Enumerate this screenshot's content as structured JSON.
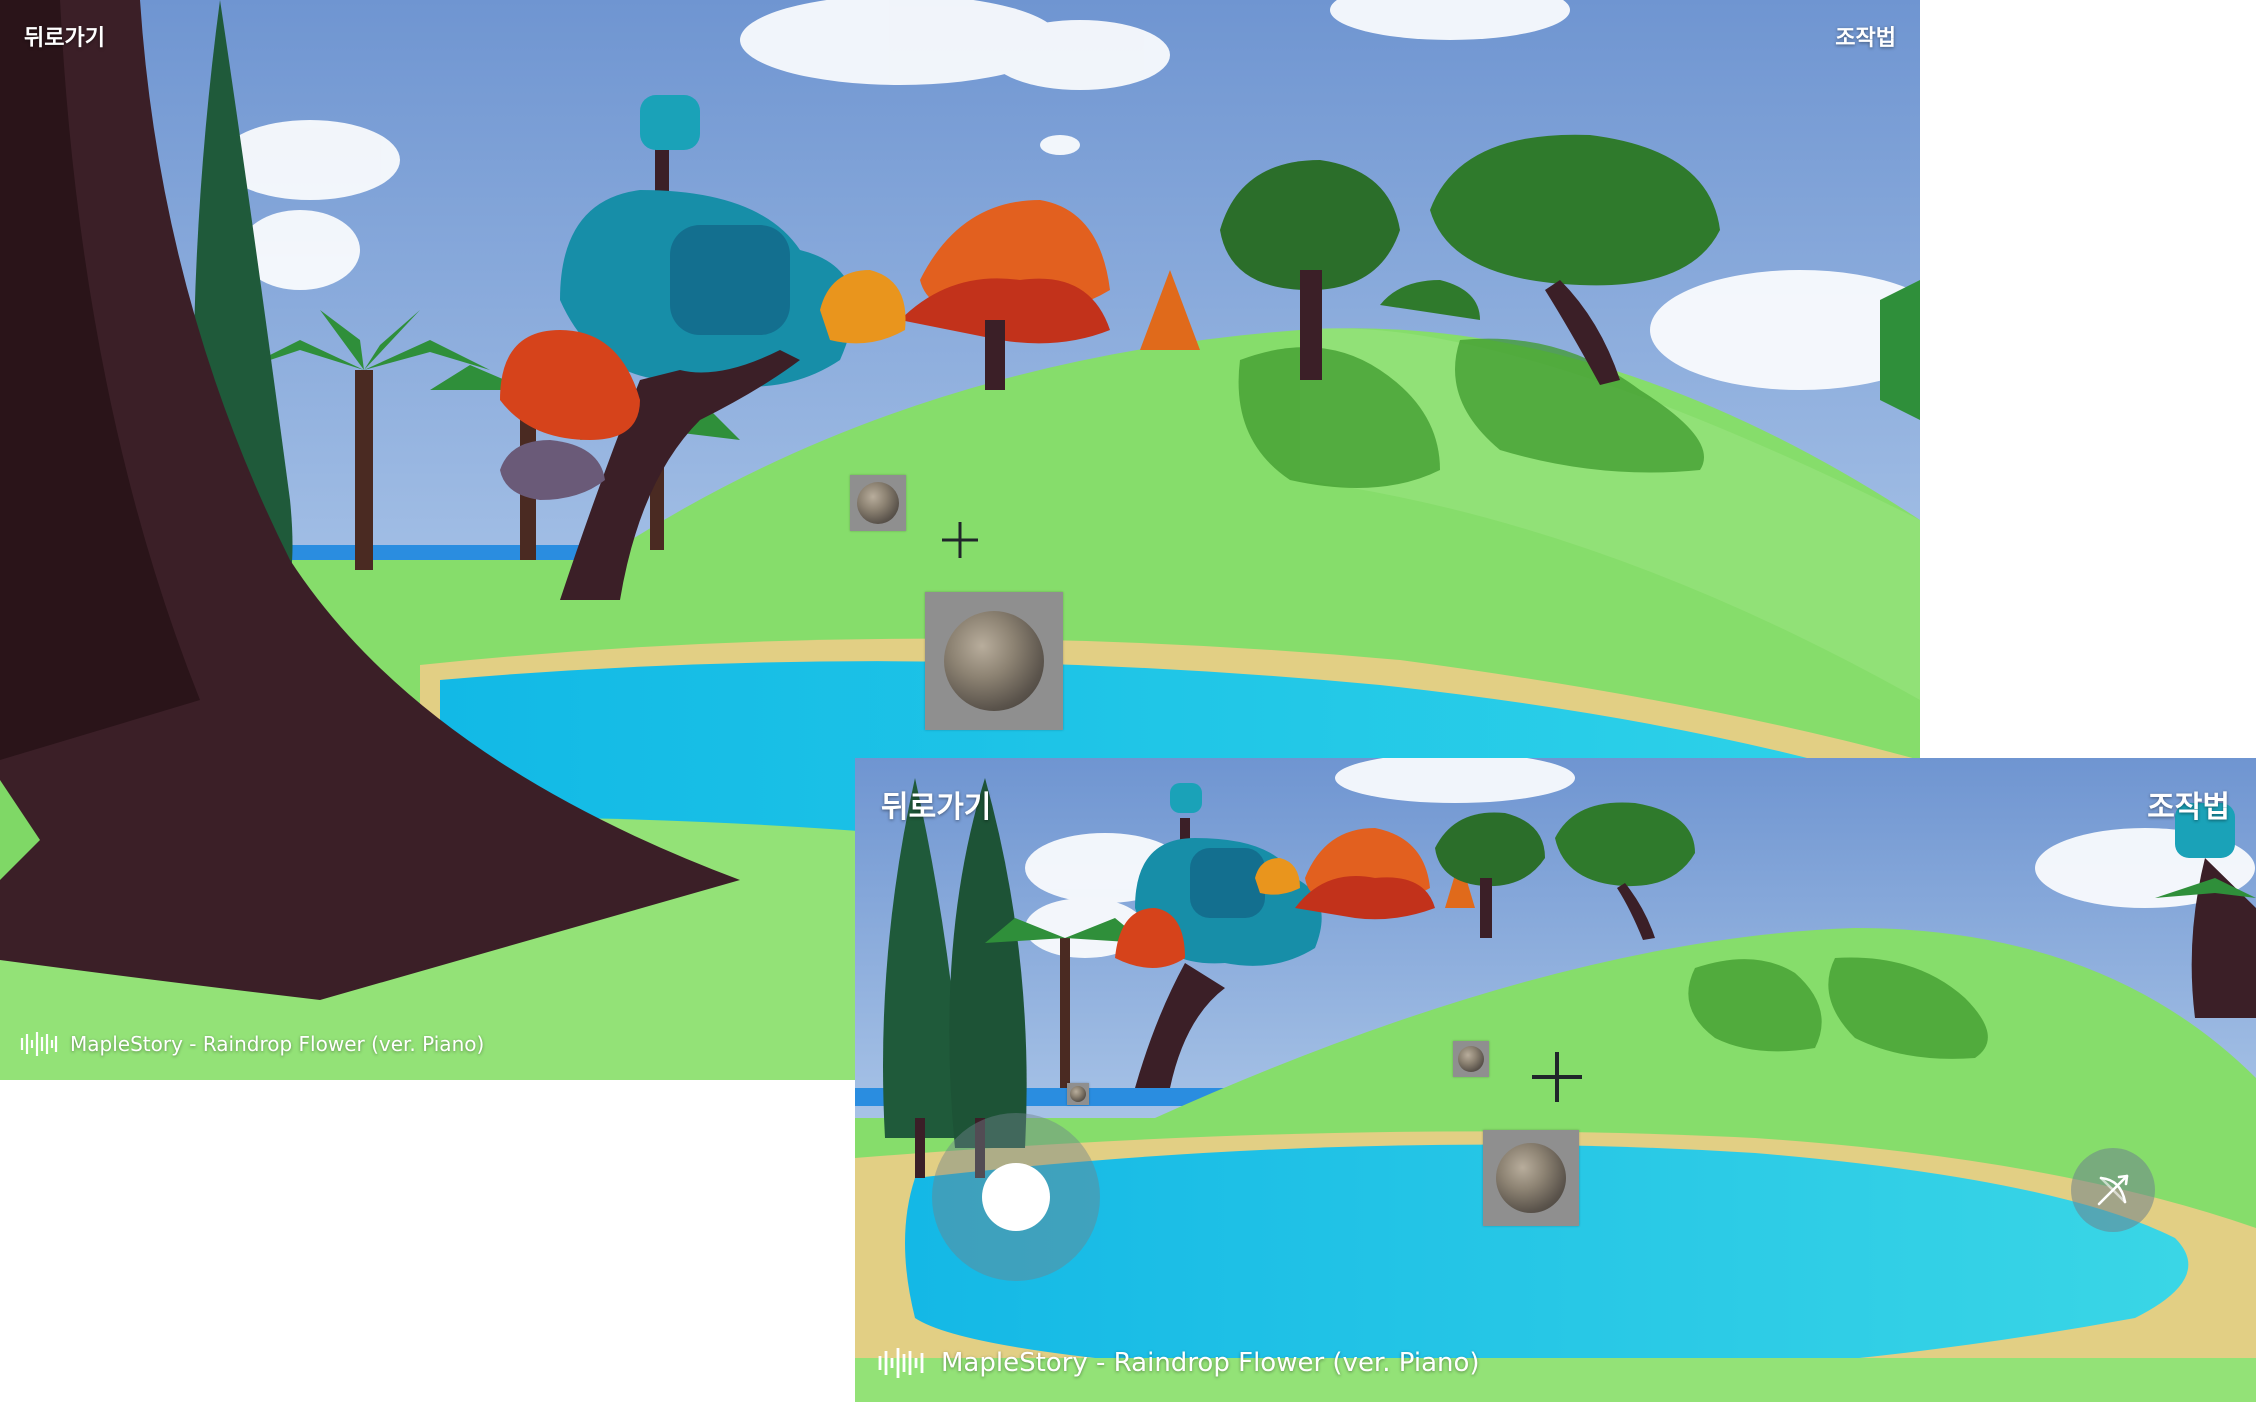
{
  "scene_a": {
    "back_label": "뒤로가기",
    "controls_label": "조작법",
    "music_title": "MapleStory - Raindrop Flower (ver. Piano)"
  },
  "scene_b": {
    "back_label": "뒤로가기",
    "controls_label": "조작법",
    "music_title": "MapleStory - Raindrop Flower (ver. Piano)"
  },
  "icons": {
    "music": "sound-wave-icon",
    "crosshair": "crosshair-icon",
    "orb": "planet-orb-icon",
    "action": "bow-arrow-icon",
    "joystick": "joystick-knob-icon"
  },
  "colors": {
    "sky_top": "#7fa3d6",
    "grass": "#7fd866",
    "water": "#1ec6ea",
    "sand": "#e2cf84",
    "trunk": "#3b1f27"
  }
}
